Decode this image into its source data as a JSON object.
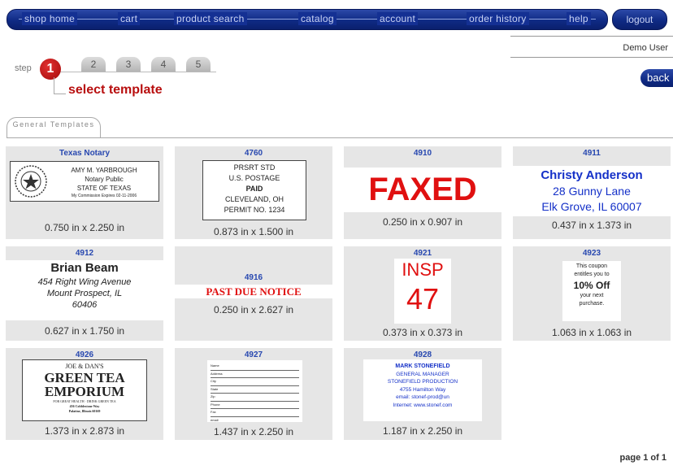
{
  "nav": {
    "items": [
      "shop home",
      "cart",
      "product search",
      "catalog",
      "account",
      "order history",
      "help"
    ],
    "logout": "logout"
  },
  "user": "Demo User",
  "back": "back",
  "steps": {
    "label": "step",
    "current": "1",
    "others": [
      "2",
      "3",
      "4",
      "5"
    ],
    "title": "select template"
  },
  "category_tab": "General Templates",
  "pager": "page 1 of 1",
  "cards": [
    {
      "id": "Texas Notary",
      "dim": "0.750 in x 2.250 in",
      "preview": {
        "lines": [
          "AMY M. YARBROUGH",
          "Notary Public",
          "STATE OF TEXAS",
          "My Commission Expires 02-11-2006"
        ]
      }
    },
    {
      "id": "4760",
      "dim": "0.873 in x 1.500 in",
      "preview": {
        "lines": [
          "PRSRT STD",
          "U.S. POSTAGE",
          "PAID",
          "CLEVELAND, OH",
          "PERMIT NO. 1234"
        ]
      }
    },
    {
      "id": "4910",
      "dim": "0.250 in x 0.907 in",
      "preview": {
        "text": "FAXED"
      }
    },
    {
      "id": "4911",
      "dim": "0.437 in x 1.373 in",
      "preview": {
        "lines": [
          "Christy Anderson",
          "28 Gunny Lane",
          "Elk Grove, IL 60007"
        ]
      }
    },
    {
      "id": "4912",
      "dim": "0.627 in x 1.750 in",
      "preview": {
        "lines": [
          "Brian Beam",
          "454 Right Wing Avenue",
          "Mount Prospect, IL",
          "60406"
        ]
      }
    },
    {
      "id": "4916",
      "dim": "0.250 in x 2.627 in",
      "preview": {
        "text": "PAST DUE NOTICE"
      }
    },
    {
      "id": "4921",
      "dim": "0.373 in x 0.373 in",
      "preview": {
        "lines": [
          "INSP",
          "47"
        ]
      }
    },
    {
      "id": "4923",
      "dim": "1.063 in x 1.063 in",
      "preview": {
        "lines": [
          "This coupon",
          "entitles you to",
          "10% Off",
          "your next",
          "purchase."
        ]
      }
    },
    {
      "id": "4926",
      "dim": "1.373 in x 2.873 in",
      "preview": {
        "lines": [
          "JOE & DAN'S",
          "GREEN TEA",
          "EMPORIUM",
          "FOR GREAT HEALTH · DRINK GREEN TEA",
          "456 Cobblestone Way",
          "Palatine, Illinois 60169"
        ]
      }
    },
    {
      "id": "4927",
      "dim": "1.437 in x 2.250 in",
      "preview": {
        "lines": [
          "Name",
          "Address",
          "City",
          "State",
          "Zip",
          "Phone",
          "Fax",
          "email"
        ]
      }
    },
    {
      "id": "4928",
      "dim": "1.187 in x 2.250 in",
      "preview": {
        "lines": [
          "MARK STONEFIELD",
          "GENERAL MANAGER",
          "STONEFIELD PRODUCTION",
          "4755 Hamilton Way",
          "email: stonef-prod@un",
          "Internet: www.stonef.com"
        ]
      }
    }
  ]
}
